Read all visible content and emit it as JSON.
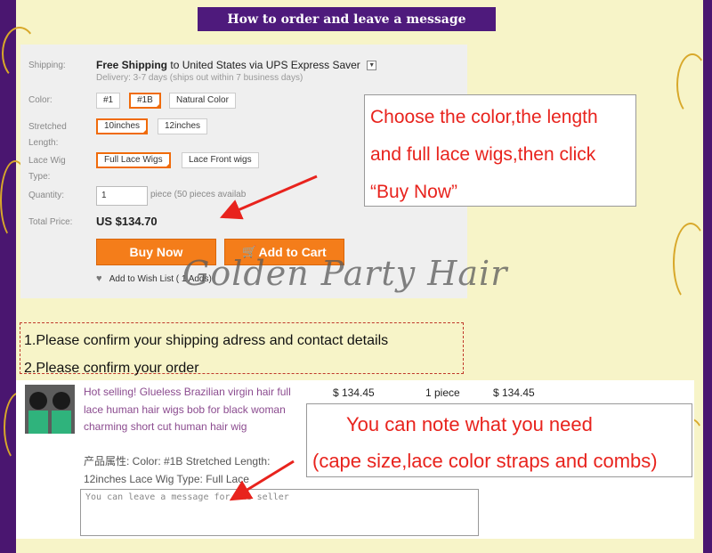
{
  "title": "How to order and leave a message",
  "shipping": {
    "label": "Shipping:",
    "free_shipping": "Free Shipping",
    "to": "to",
    "destination": "United States via UPS Express Saver",
    "delivery": "Delivery: 3-7 days (ships out within 7 business days)"
  },
  "color": {
    "label": "Color:",
    "options": [
      "#1",
      "#1B",
      "Natural Color"
    ],
    "selected": "#1B"
  },
  "stretched_length": {
    "label_line1": "Stretched",
    "label_line2": "Length:",
    "options": [
      "10inches",
      "12inches"
    ],
    "selected": "10inches"
  },
  "lace_wig_type": {
    "label_line1": "Lace Wig",
    "label_line2": "Type:",
    "options": [
      "Full Lace Wigs",
      "Lace Front wigs"
    ],
    "selected": "Full Lace Wigs"
  },
  "quantity": {
    "label": "Quantity:",
    "value": "1",
    "note": "piece (50 pieces availab"
  },
  "total": {
    "label": "Total Price:",
    "value": "US $134.70"
  },
  "buttons": {
    "buy_now": "Buy Now",
    "add_to_cart": "Add to Cart",
    "wish_list": "Add to Wish List (",
    "wish_list_count": "1 Adds)"
  },
  "watermark": "Golden Party Hair",
  "callout_top": {
    "lines": [
      "Choose the color,the length",
      "and full lace wigs,then click",
      "“Buy Now”"
    ]
  },
  "steps": [
    "1.Please confirm your shipping adress and contact details",
    "2.Please confirm your order"
  ],
  "order": {
    "product_title": "Hot selling! Glueless Brazilian virgin hair full lace human hair wigs bob for black woman charming short cut human hair wig",
    "attributes": "产品属性: Color: #1B    Stretched Length: 12inches    Lace Wig Type: Full Lace",
    "unit_price": "$ 134.45",
    "quantity": "1 piece",
    "subtotal": "$ 134.45",
    "message_placeholder": "You can leave a message for the seller"
  },
  "callout_bottom": {
    "lines": [
      "You can note what you need",
      "(cape size,lace color straps and combs)"
    ]
  },
  "colors": {
    "title_bg": "#4e1a7c",
    "page_bg": "#f7f4c8",
    "accent_orange": "#f47d1a",
    "callout_red": "#e8231d",
    "product_link": "#8b4b8f"
  }
}
